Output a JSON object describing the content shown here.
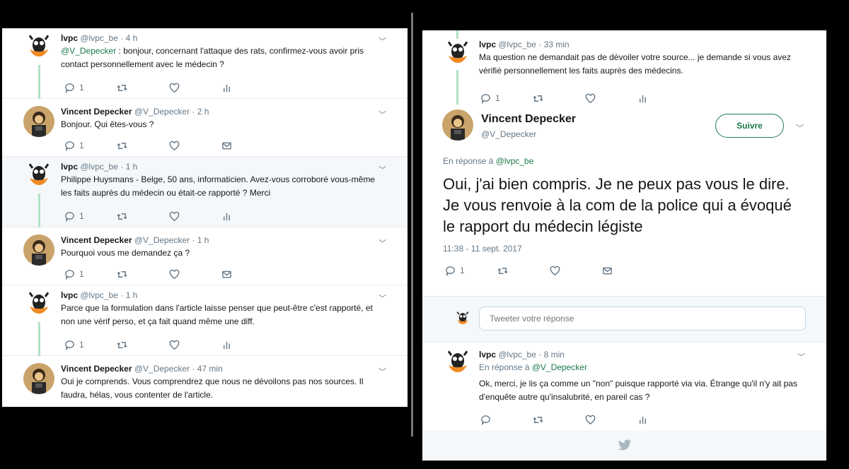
{
  "left": {
    "tweets": [
      {
        "name": "lvpc",
        "meta": "@lvpc_be · 4 h",
        "mention": "@V_Depecker",
        "text": " : bonjour, concernant l'attaque des rats, confirmez-vous avoir pris contact personnellement avec le médecin ?",
        "reply_count": "1"
      },
      {
        "name": "Vincent Depecker",
        "meta": "@V_Depecker · 2 h",
        "text": "Bonjour. Qui êtes-vous ?",
        "reply_count": "1"
      },
      {
        "name": "lvpc",
        "meta": "@lvpc_be · 1 h",
        "text": "Philippe Huysmans - Belge, 50 ans, informaticien.  Avez-vous corroboré vous-même les faits auprès du médecin ou était-ce rapporté ?  Merci",
        "reply_count": "1"
      },
      {
        "name": "Vincent Depecker",
        "meta": "@V_Depecker · 1 h",
        "text": "Pourquoi vous me demandez ça ?",
        "reply_count": "1"
      },
      {
        "name": "lvpc",
        "meta": "@lvpc_be · 1 h",
        "text": "Parce que la formulation dans l'article laisse penser que peut-être c'est rapporté, et non une vérif perso, et ça fait quand même une diff.",
        "reply_count": "1"
      },
      {
        "name": "Vincent Depecker",
        "meta": "@V_Depecker · 47 min",
        "text": "Oui je comprends. Vous comprendrez que nous ne dévoilons pas nos sources. Il faudra, hélas, vous contenter de l'article."
      }
    ]
  },
  "right": {
    "top": {
      "name": "lvpc",
      "meta": "@lvpc_be · 33 min",
      "text": "Ma question ne demandait pas de dévoiler votre source...  je demande si vous avez vérifié personnellement les faits auprès des médecins.",
      "reply_count": "1"
    },
    "main": {
      "name": "Vincent Depecker",
      "handle": "@V_Depecker",
      "follow_label": "Suivre",
      "reply_to_prefix": "En réponse à ",
      "reply_to_handle": "@lvpc_be",
      "text": "Oui, j'ai bien compris. Je ne peux pas vous le dire. Je vous renvoie à la com de la police qui a évoqué le rapport du médecin légiste",
      "date": "11:38 - 11 sept. 2017",
      "reply_count": "1"
    },
    "reply_placeholder": "Tweeter votre réponse",
    "last": {
      "name": "lvpc",
      "meta": "@lvpc_be · 8 min",
      "reply_to_prefix": "En réponse à ",
      "reply_to_handle": "@V_Depecker",
      "text": "Ok, merci, je lis ça comme un \"non\" puisque rapporté via via.  Étrange qu'il n'y ait pas d'enquête autre qu'insalubrité, en pareil cas ?"
    }
  },
  "icons": [
    "reply-icon",
    "retweet-icon",
    "like-icon",
    "analytics-icon",
    "message-icon",
    "chevron-down-icon",
    "twitter-bird-icon"
  ],
  "colors": {
    "accent": "#1a7a4a",
    "thread": "#b1e1c7",
    "highlight": "#f5f8fa",
    "muted": "#657786"
  }
}
